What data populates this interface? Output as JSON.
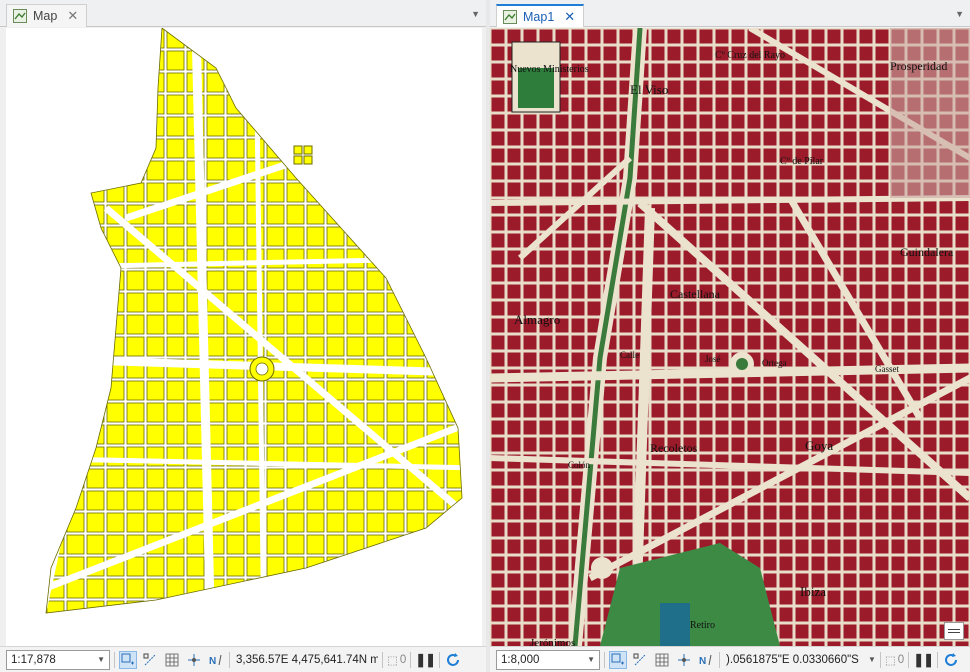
{
  "left_pane": {
    "tab_label": "Map",
    "scale": "1:17,878",
    "coordinates": "3,356.57E 4,475,641.74N m",
    "selected_count": "0"
  },
  "right_pane": {
    "tab_label": "Map1",
    "scale": "1:8,000",
    "coordinates": ").0561875\"E 0.0330660\"S",
    "selected_count": "0"
  },
  "map_labels": [
    "Nuevos Ministerios",
    "El Viso",
    "Castellana",
    "Almagro",
    "Recoletos",
    "Goya",
    "Ibiza",
    "Jerónimos",
    "Guindalera",
    "Prosperidad",
    "Cº de Pilar",
    "Cº Cruz del Rayo",
    "Calle",
    "José",
    "Ortega",
    "Gasset",
    "Colón",
    "Retiro"
  ],
  "colors": {
    "accent": "#1f7fd6",
    "yellow_fill": "#ffff00",
    "map_red": "#9b1b2a",
    "park_green": "#2e7d3a"
  }
}
